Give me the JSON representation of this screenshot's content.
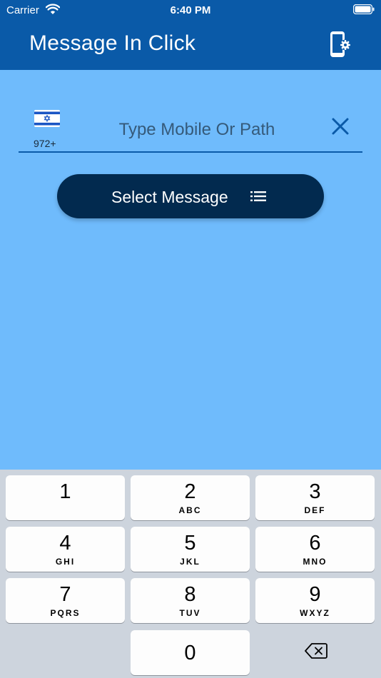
{
  "status_bar": {
    "carrier": "Carrier",
    "time": "6:40 PM"
  },
  "header": {
    "title": "Message In Click",
    "settings_icon": "phone-settings-icon",
    "background_color": "#0a5aa8"
  },
  "phone_entry": {
    "country_flag": "israel-flag-icon",
    "country_code": "972+",
    "placeholder": "Type Mobile Or Path",
    "value": "",
    "clear_icon": "close-icon"
  },
  "select_message_button": {
    "label": "Select Message",
    "icon": "list-icon",
    "background_color": "#022a4f"
  },
  "keyboard": {
    "keys": [
      {
        "digit": "1",
        "letters": ""
      },
      {
        "digit": "2",
        "letters": "ABC"
      },
      {
        "digit": "3",
        "letters": "DEF"
      },
      {
        "digit": "4",
        "letters": "GHI"
      },
      {
        "digit": "5",
        "letters": "JKL"
      },
      {
        "digit": "6",
        "letters": "MNO"
      },
      {
        "digit": "7",
        "letters": "PQRS"
      },
      {
        "digit": "8",
        "letters": "TUV"
      },
      {
        "digit": "9",
        "letters": "WXYZ"
      },
      {
        "digit": "0",
        "letters": ""
      }
    ],
    "backspace_icon": "backspace-icon"
  },
  "colors": {
    "page_background": "#6fbbfc",
    "keyboard_background": "#cdd4dd"
  }
}
